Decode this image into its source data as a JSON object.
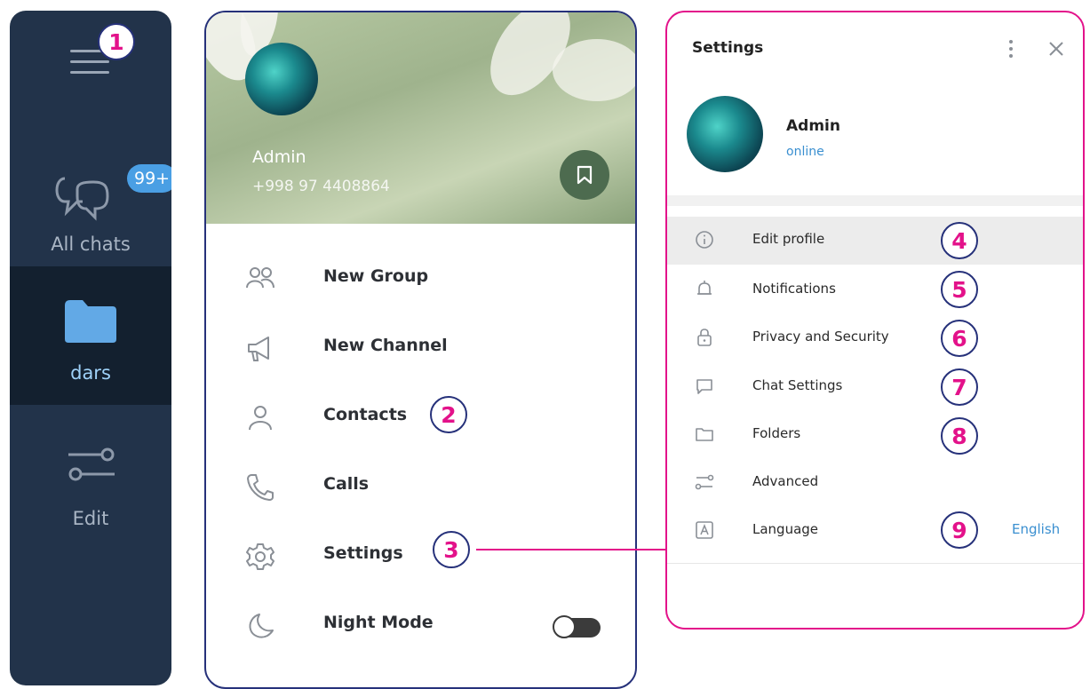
{
  "sidebar": {
    "folders": [
      {
        "label": "All chats",
        "badge": "99+",
        "icon": "chats-icon"
      },
      {
        "label": "dars",
        "icon": "folder-icon",
        "active": true
      },
      {
        "label": "Edit",
        "icon": "sliders-icon"
      }
    ]
  },
  "menu": {
    "profile": {
      "name": "Admin",
      "phone": "+998 97 4408864"
    },
    "items": [
      {
        "label": "New Group",
        "icon": "group-icon"
      },
      {
        "label": "New Channel",
        "icon": "megaphone-icon"
      },
      {
        "label": "Contacts",
        "icon": "contact-icon"
      },
      {
        "label": "Calls",
        "icon": "phone-icon"
      },
      {
        "label": "Settings",
        "icon": "gear-icon"
      },
      {
        "label": "Night Mode",
        "icon": "moon-icon",
        "toggle": false
      }
    ]
  },
  "settings": {
    "title": "Settings",
    "profile": {
      "name": "Admin",
      "status": "online"
    },
    "rows": [
      {
        "label": "Edit profile",
        "icon": "info-icon"
      },
      {
        "label": "Notifications",
        "icon": "bell-icon"
      },
      {
        "label": "Privacy and Security",
        "icon": "lock-icon"
      },
      {
        "label": "Chat Settings",
        "icon": "chat-bubble-icon"
      },
      {
        "label": "Folders",
        "icon": "folder-outline-icon"
      },
      {
        "label": "Advanced",
        "icon": "sliders-icon"
      },
      {
        "label": "Language",
        "icon": "letter-a-icon",
        "value": "English"
      }
    ]
  },
  "callouts": [
    "1",
    "2",
    "3",
    "4",
    "5",
    "6",
    "7",
    "8",
    "9"
  ],
  "colors": {
    "accent_magenta": "#e3128a",
    "navy": "#26317a",
    "sidebar_bg": "#22334a",
    "link_blue": "#3a8fd0"
  }
}
